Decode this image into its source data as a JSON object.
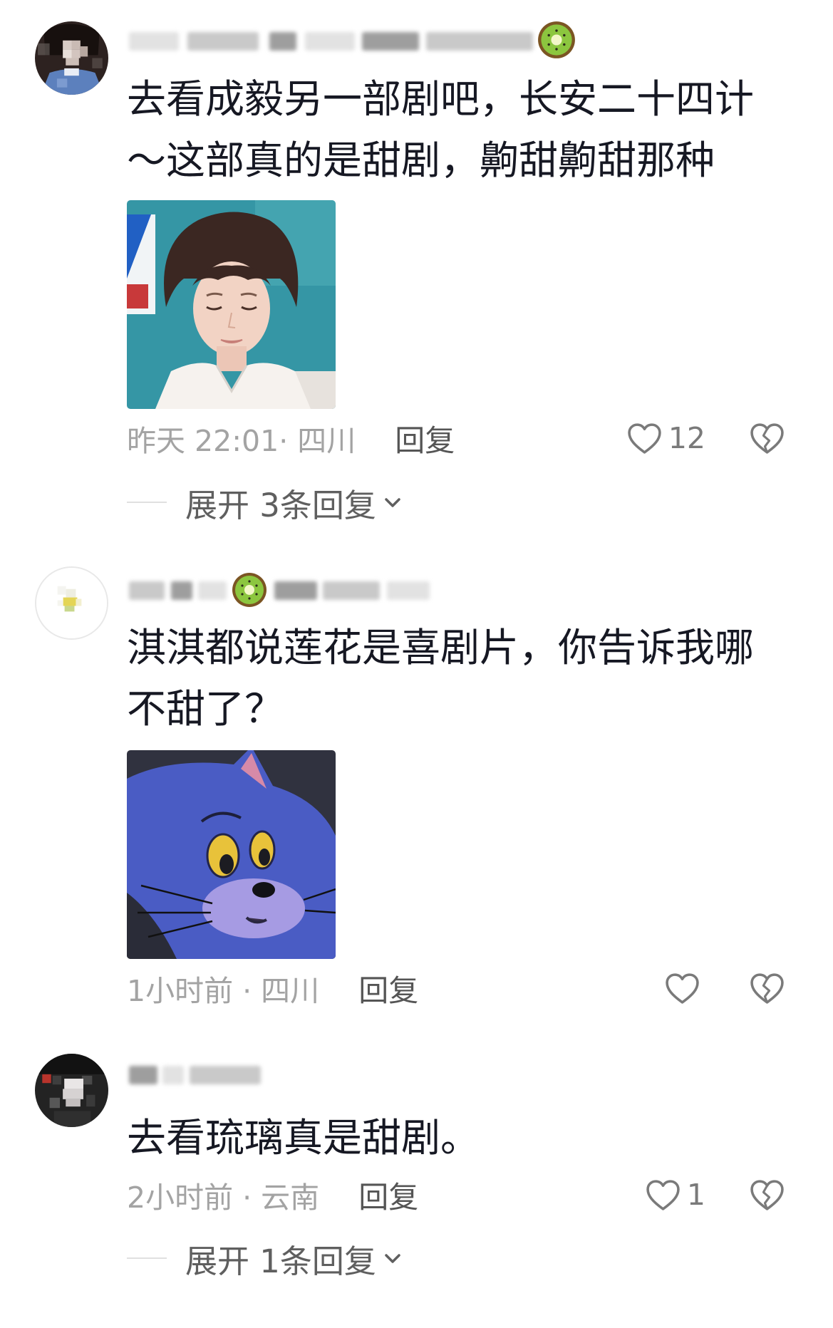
{
  "comments": [
    {
      "text_lines": [
        "去看成毅另一部剧吧，长安二十四计",
        "～这部真的是甜剧，齁甜齁甜那种"
      ],
      "meta": "昨天 22:01· 四川",
      "reply_label": "回复",
      "like_count": "12",
      "expand_replies_label": "展开 3条回复"
    },
    {
      "text_lines": [
        "淇淇都说莲花是喜剧片，你告诉我哪",
        "不甜了？"
      ],
      "meta": "1小时前 · 四川",
      "reply_label": "回复"
    },
    {
      "text_lines": [
        "去看琉璃真是甜剧。"
      ],
      "meta": "2小时前 · 云南",
      "reply_label": "回复",
      "like_count": "1",
      "expand_replies_label": "展开 1条回复"
    }
  ],
  "icons": {
    "like": "heart-outline-icon",
    "dislike": "broken-heart-icon",
    "expand": "chevron-down-icon",
    "username_badge": "kiwi-emoji"
  },
  "colors": {
    "background": "#ffffff",
    "comment_text": "#161823",
    "meta_text": "#a3a3a3",
    "reply_text": "#555555",
    "icon_stroke": "#7a7a7a"
  }
}
